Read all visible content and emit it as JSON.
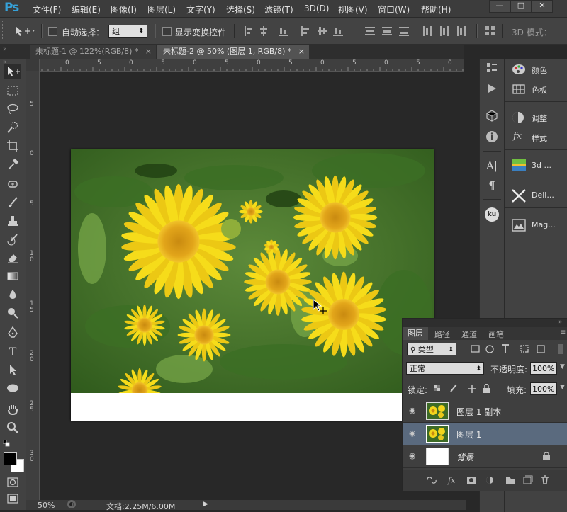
{
  "app": {
    "logo": "Ps"
  },
  "menu": [
    "文件(F)",
    "编辑(E)",
    "图像(I)",
    "图层(L)",
    "文字(Y)",
    "选择(S)",
    "滤镜(T)",
    "3D(D)",
    "视图(V)",
    "窗口(W)",
    "帮助(H)"
  ],
  "window_controls": {
    "minimize": "—",
    "restore": "□",
    "close": "✕"
  },
  "options": {
    "auto_select_label": "自动选择：",
    "auto_select_value": "组",
    "show_transform_label": "显示变换控件",
    "mode_3d_label": "3D 模式："
  },
  "tabs": [
    {
      "title": "未标题-1 @ 122%(RGB/8) *",
      "close": "×"
    },
    {
      "title": "未标题-2 @ 50% (图层 1, RGB/8) *",
      "close": "×"
    }
  ],
  "ruler": {
    "h_labels": [
      "5",
      "0",
      "5",
      "0",
      "5",
      "0",
      "5",
      "0",
      "5",
      "0",
      "5",
      "0",
      "5",
      "0"
    ],
    "v_labels": [
      "5",
      "0",
      "5",
      "1 0",
      "1 5",
      "2 0",
      "2 5",
      "3 0"
    ]
  },
  "status": {
    "zoom": "50%",
    "doc_info": "文档:2.25M/6.00M"
  },
  "right_panels": [
    {
      "label": "颜色",
      "icon": "palette-icon"
    },
    {
      "label": "色板",
      "icon": "swatches-icon"
    },
    {
      "label": "调整",
      "icon": "adjustments-icon"
    },
    {
      "label": "样式",
      "icon": "styles-icon"
    },
    {
      "label": "3d ...",
      "icon": "3d-icon"
    },
    {
      "label": "Deli...",
      "icon": "delicious-icon"
    },
    {
      "label": "Mag...",
      "icon": "magazine-icon"
    }
  ],
  "layers_panel": {
    "tabs": [
      "图层",
      "路径",
      "通道",
      "画笔"
    ],
    "filter_label": "类型",
    "blend_mode": "正常",
    "opacity_label": "不透明度:",
    "opacity_value": "100%",
    "lock_label": "锁定:",
    "fill_label": "填充:",
    "fill_value": "100%",
    "layers": [
      {
        "name": "图层 1 副本",
        "selected": false,
        "italic": false,
        "locked": false
      },
      {
        "name": "图层 1",
        "selected": true,
        "italic": false,
        "locked": false
      },
      {
        "name": "背景",
        "selected": false,
        "italic": true,
        "locked": true
      }
    ]
  },
  "colors": {
    "accent": "#36a1d8",
    "selected_layer": "#5a6a7e",
    "foreground": "#000000",
    "background": "#ffffff"
  }
}
